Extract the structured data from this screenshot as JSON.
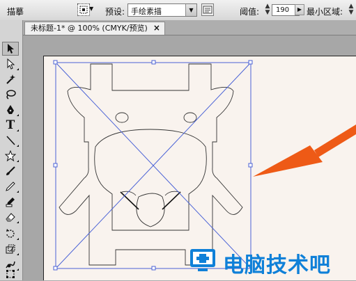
{
  "control_bar": {
    "tracing_label": "描摹",
    "preset_label": "预设:",
    "preset_value": "手绘素描",
    "threshold_label": "阈值:",
    "threshold_value": "190",
    "min_area_label": "最小区域:"
  },
  "document_tab": {
    "title": "未标题-1* @ 100% (CMYK/预览)",
    "close": "×"
  },
  "toolbox": {
    "tools": [
      "selection-tool-icon",
      "direct-selection-tool-icon",
      "magic-wand-tool-icon",
      "lasso-tool-icon",
      "pen-tool-icon",
      "type-tool-icon",
      "line-tool-icon",
      "star-tool-icon",
      "paintbrush-tool-icon",
      "pencil-tool-icon",
      "blob-brush-tool-icon",
      "eraser-tool-icon",
      "rotate-tool-icon",
      "scale-tool-icon",
      "warp-tool-icon",
      "free-transform-tool-icon"
    ],
    "type_glyph": "T"
  },
  "colors": {
    "arrow": "#ee5a16",
    "watermark": "#0f80d8",
    "selection": "#4a62d6"
  },
  "watermark": {
    "text": "电脑技术吧"
  }
}
